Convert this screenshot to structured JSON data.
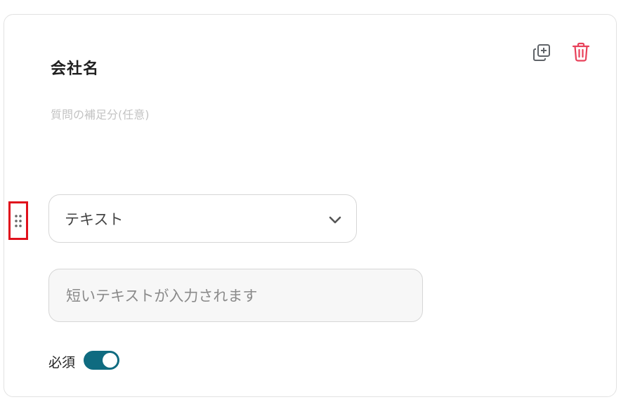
{
  "question": {
    "title": "会社名",
    "note_placeholder": "質問の補足分(任意)"
  },
  "actions": {
    "copy_icon": "copy-plus-icon",
    "delete_icon": "trash-icon",
    "delete_color": "#e8415a"
  },
  "type_select": {
    "selected": "テキスト"
  },
  "answer": {
    "placeholder": "短いテキストが入力されます"
  },
  "required": {
    "label": "必須",
    "enabled": true,
    "accent": "#0f6b80"
  },
  "highlight_color": "#e0101c"
}
